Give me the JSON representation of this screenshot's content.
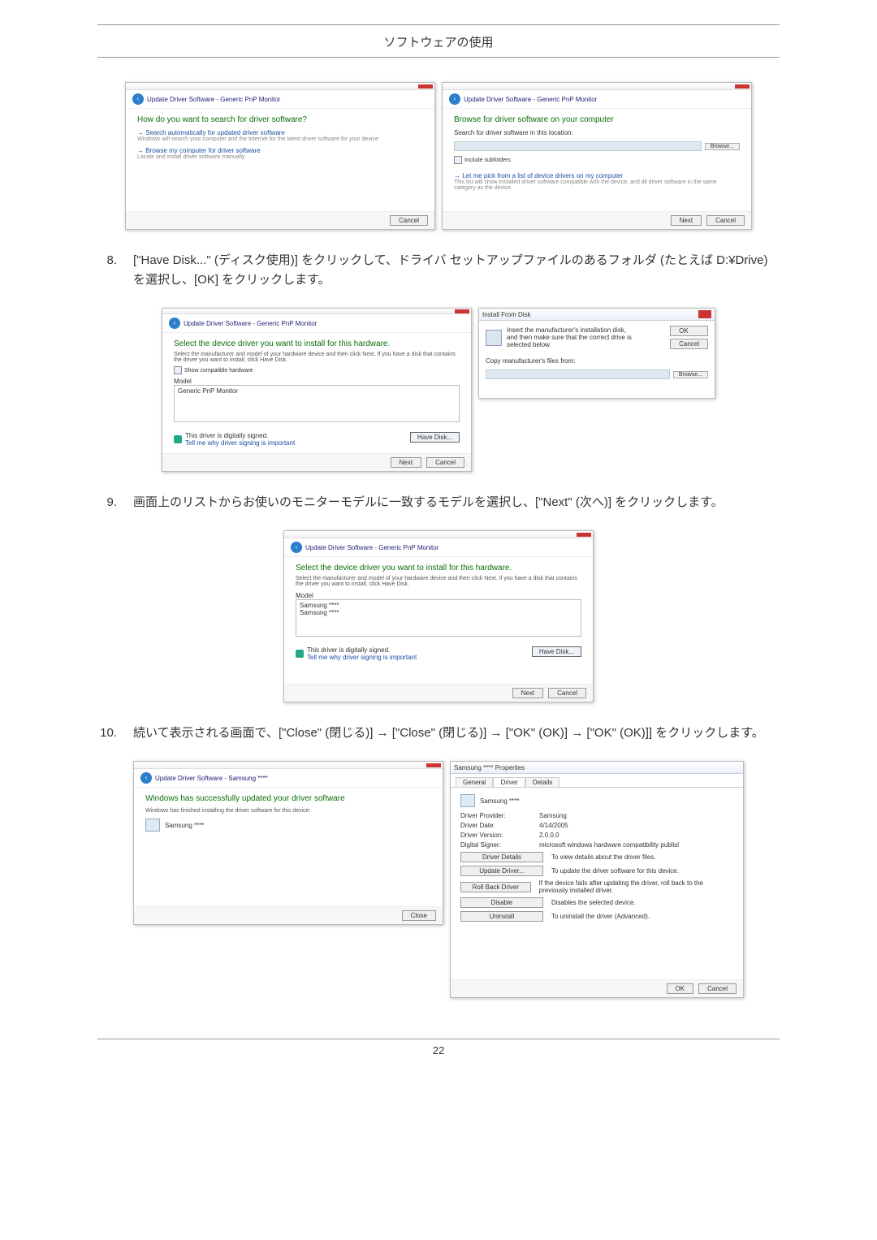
{
  "page": {
    "header": "ソフトウェアの使用",
    "pagenum": "22"
  },
  "steps": {
    "s8_num": "8.",
    "s8": "[\"Have Disk...\" (ディスク使用)] をクリックして、ドライバ セットアップファイルのあるフォルダ (たとえば D:¥Drive) を選択し、[OK] をクリックします。",
    "s9_num": "9.",
    "s9": "画面上のリストからお使いのモニターモデルに一致するモデルを選択し、[\"Next\" (次へ)] をクリックします。",
    "s10_num": "10.",
    "s10": "続いて表示される画面で、[\"Close\" (閉じる)] → [\"Close\" (閉じる)] → [\"OK\" (OK)] → [\"OK\" (OK)]] をクリックします。"
  },
  "win1l": {
    "title": "Update Driver Software - Generic PnP Monitor",
    "q": "How do you want to search for driver software?",
    "opt1": "Search automatically for updated driver software",
    "opt1sub": "Windows will search your computer and the Internet for the latest driver software for your device.",
    "opt2": "Browse my computer for driver software",
    "opt2sub": "Locate and install driver software manually.",
    "cancel": "Cancel"
  },
  "win1r": {
    "title": "Update Driver Software - Generic PnP Monitor",
    "h": "Browse for driver software on your computer",
    "srch": "Search for driver software in this location:",
    "browse": "Browse...",
    "chk": "Include subfolders",
    "pick": "Let me pick from a list of device drivers on my computer",
    "picksub": "This list will show installed driver software compatible with the device, and all driver software in the same category as the device.",
    "next": "Next",
    "cancel": "Cancel"
  },
  "win2l": {
    "title": "Update Driver Software - Generic PnP Monitor",
    "h": "Select the device driver you want to install for this hardware.",
    "sub": "Select the manufacturer and model of your hardware device and then click Next. If you have a disk that contains the driver you want to install, click Have Disk.",
    "chk": "Show compatible hardware",
    "model": "Model",
    "item": "Generic PnP Monitor",
    "sig": "This driver is digitally signed.",
    "siglink": "Tell me why driver signing is important",
    "have": "Have Disk...",
    "next": "Next",
    "cancel": "Cancel"
  },
  "win2r": {
    "title": "Install From Disk",
    "msg": "Insert the manufacturer's installation disk, and then make sure that the correct drive is selected below.",
    "ok": "OK",
    "cancel": "Cancel",
    "copy": "Copy manufacturer's files from:",
    "browse": "Browse..."
  },
  "win3": {
    "title": "Update Driver Software - Generic PnP Monitor",
    "h": "Select the device driver you want to install for this hardware.",
    "sub": "Select the manufacturer and model of your hardware device and then click Next. If you have a disk that contains the driver you want to install, click Have Disk.",
    "model": "Model",
    "item1": "Samsung ****",
    "item2": "Samsung ****",
    "sig": "This driver is digitally signed.",
    "siglink": "Tell me why driver signing is important",
    "have": "Have Disk...",
    "next": "Next",
    "cancel": "Cancel"
  },
  "win4l": {
    "title": "Update Driver Software - Samsung ****",
    "h": "Windows has successfully updated your driver software",
    "sub": "Windows has finished installing the driver software for this device:",
    "item": "Samsung ****",
    "close": "Close"
  },
  "win4r": {
    "title": "Samsung **** Properties",
    "tab1": "General",
    "tab2": "Driver",
    "tab3": "Details",
    "dev": "Samsung ****",
    "k1": "Driver Provider:",
    "v1": "Samsung",
    "k2": "Driver Date:",
    "v2": "4/14/2005",
    "k3": "Driver Version:",
    "v3": "2.0.0.0",
    "k4": "Digital Signer:",
    "v4": "microsoft windows hardware compatibility publisl",
    "b1": "Driver Details",
    "d1": "To view details about the driver files.",
    "b2": "Update Driver...",
    "d2": "To update the driver software for this device.",
    "b3": "Roll Back Driver",
    "d3": "If the device fails after updating the driver, roll back to the previously installed driver.",
    "b4": "Disable",
    "d4": "Disables the selected device.",
    "b5": "Uninstall",
    "d5": "To uninstall the driver (Advanced).",
    "ok": "OK",
    "cancel": "Cancel"
  }
}
